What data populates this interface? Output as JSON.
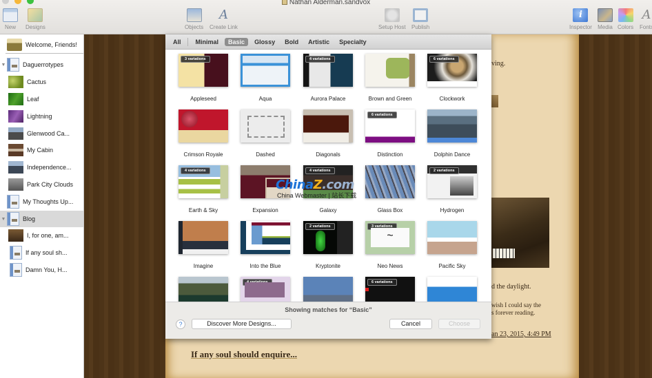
{
  "window": {
    "title": "Nathan Alderman.sandvox"
  },
  "toolbar": {
    "items": [
      {
        "id": "new",
        "label": "New"
      },
      {
        "id": "designs",
        "label": "Designs"
      },
      {
        "id": "objects",
        "label": "Objects"
      },
      {
        "id": "create_link",
        "label": "Create Link"
      },
      {
        "id": "setup_host",
        "label": "Setup Host"
      },
      {
        "id": "publish",
        "label": "Publish"
      },
      {
        "id": "inspector",
        "label": "Inspector"
      },
      {
        "id": "media",
        "label": "Media"
      },
      {
        "id": "colors",
        "label": "Colors"
      },
      {
        "id": "fonts",
        "label": "Fonts"
      }
    ],
    "icons": {
      "inspector_glyph": "i",
      "fonts_glyph": "A",
      "create_link_glyph": "A"
    }
  },
  "sidebar": {
    "items": [
      {
        "label": "Welcome, Friends!",
        "icon": "home-page-icon",
        "level": 0
      },
      {
        "label": "Daguerrotypes",
        "icon": "page-icon",
        "level": 0,
        "expanded": true
      },
      {
        "label": "Cactus",
        "icon": "photo-thumbnail",
        "level": 1
      },
      {
        "label": "Leaf",
        "icon": "photo-thumbnail",
        "level": 1
      },
      {
        "label": "Lightning",
        "icon": "photo-thumbnail",
        "level": 1
      },
      {
        "label": "Glenwood Ca...",
        "icon": "photo-thumbnail",
        "level": 1
      },
      {
        "label": "My Cabin",
        "icon": "photo-thumbnail",
        "level": 1
      },
      {
        "label": "Independence...",
        "icon": "photo-thumbnail",
        "level": 1
      },
      {
        "label": "Park City Clouds",
        "icon": "photo-thumbnail",
        "level": 1
      },
      {
        "label": "My Thoughts Up...",
        "icon": "page-icon",
        "level": 0
      },
      {
        "label": "Blog",
        "icon": "page-icon",
        "level": 0,
        "expanded": true,
        "selected": true
      },
      {
        "label": "I, for one, am...",
        "icon": "photo-thumbnail",
        "level": 1
      },
      {
        "label": "If any soul sh...",
        "icon": "page-icon",
        "level": 1
      },
      {
        "label": "Damn You, H...",
        "icon": "page-icon",
        "level": 1
      }
    ]
  },
  "design_chooser": {
    "tabs": [
      {
        "label": "All",
        "active": false
      },
      {
        "label": "Minimal",
        "active": false
      },
      {
        "label": "Basic",
        "active": true
      },
      {
        "label": "Glossy",
        "active": false
      },
      {
        "label": "Bold",
        "active": false
      },
      {
        "label": "Artistic",
        "active": false
      },
      {
        "label": "Specialty",
        "active": false
      }
    ],
    "designs": [
      {
        "name": "Appleseed",
        "variations": "3 variations"
      },
      {
        "name": "Aqua",
        "variations": ""
      },
      {
        "name": "Aurora Palace",
        "variations": "4 variations"
      },
      {
        "name": "Brown and Green",
        "variations": ""
      },
      {
        "name": "Clockwork",
        "variations": "6 variations"
      },
      {
        "name": "Crimson Royale",
        "variations": ""
      },
      {
        "name": "Dashed",
        "variations": ""
      },
      {
        "name": "Diagonals",
        "variations": ""
      },
      {
        "name": "Distinction",
        "variations": "6 variations"
      },
      {
        "name": "Dolphin Dance",
        "variations": ""
      },
      {
        "name": "Earth & Sky",
        "variations": "4 variations"
      },
      {
        "name": "Expansion",
        "variations": ""
      },
      {
        "name": "Galaxy",
        "variations": "4 variations"
      },
      {
        "name": "Glass Box",
        "variations": ""
      },
      {
        "name": "Hydrogen",
        "variations": "2 variations"
      },
      {
        "name": "Imagine",
        "variations": ""
      },
      {
        "name": "Into the Blue",
        "variations": ""
      },
      {
        "name": "Kryptonite",
        "variations": "2 variations"
      },
      {
        "name": "Neo News",
        "variations": "3 variations"
      },
      {
        "name": "Pacific Sky",
        "variations": ""
      },
      {
        "name": "",
        "variations": ""
      },
      {
        "name": "",
        "variations": "4 variations"
      },
      {
        "name": "",
        "variations": ""
      },
      {
        "name": "",
        "variations": "6 variations"
      },
      {
        "name": "",
        "variations": ""
      }
    ],
    "status": "Showing matches for “Basic”",
    "help_label": "?",
    "discover_label": "Discover More Designs...",
    "cancel_label": "Cancel",
    "choose_label": "Choose",
    "choose_enabled": false
  },
  "page_preview": {
    "text_fragments": {
      "line1": "ving.",
      "line2": "d the daylight.",
      "line3": "wish I could say the",
      "line4": "s forever reading.",
      "timestamp": "an 23, 2015, 4:49 PM"
    },
    "post_heading": "If any soul should enquire..."
  },
  "watermark": {
    "logo_part1": "China",
    "logo_part2": "Z",
    "logo_part3": ".com",
    "subtitle": "China Webmaster | 站长下载"
  }
}
